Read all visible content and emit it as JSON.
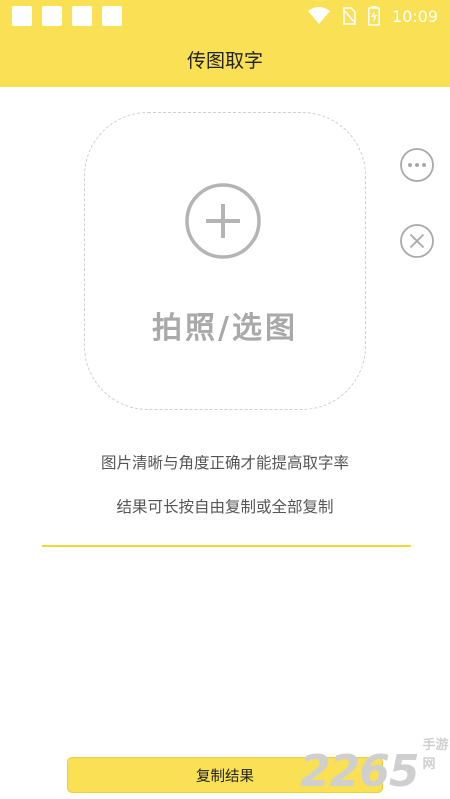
{
  "status_bar": {
    "time": "10:09",
    "icons": [
      "notification-icon",
      "notification-icon",
      "notification-icon",
      "notification-icon",
      "wifi-icon",
      "no-sim-icon",
      "battery-charging-icon"
    ]
  },
  "header": {
    "title": "传图取字"
  },
  "upload": {
    "label": "拍照/选图",
    "icon": "plus-circle-icon"
  },
  "side_actions": {
    "more_icon": "more-icon",
    "close_icon": "close-icon"
  },
  "hints": {
    "line1": "图片清晰与角度正确才能提高取字率",
    "line2": "结果可长按自由复制或全部复制"
  },
  "result": {
    "text": ""
  },
  "footer": {
    "copy_label": "复制结果"
  },
  "watermark": {
    "number": "2265",
    "text": "手游网"
  },
  "colors": {
    "accent": "#f9e055",
    "divider": "#f1d73a",
    "muted": "#a9a9a9"
  }
}
